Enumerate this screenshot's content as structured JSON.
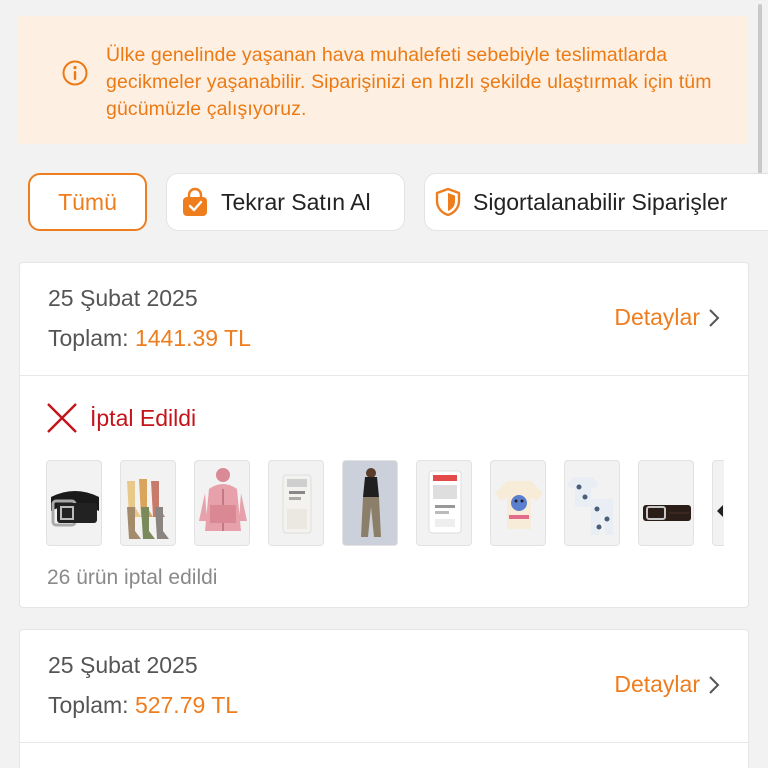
{
  "notice": {
    "text": "Ülke genelinde yaşanan hava muhalefeti sebebiyle teslimatlarda gecikmeler yaşanabilir. Siparişinizi en hızlı şekilde ulaştırmak için tüm gücümüzle çalışıyoruz.",
    "icon": "info-icon"
  },
  "filters": [
    {
      "label": "Tümü",
      "active": true
    },
    {
      "label": "Tekrar Satın Al",
      "icon": "shopping-bag-icon"
    },
    {
      "label": "Sigortalanabilir Siparişler",
      "icon": "shield-icon"
    }
  ],
  "orders": [
    {
      "date": "25 Şubat 2025",
      "total_label": "Toplam:",
      "total_value": "1441.39 TL",
      "details_label": "Detaylar",
      "status": "İptal Edildi",
      "canceled_count": "26 ürün iptal edildi",
      "products": [
        "belt",
        "socks",
        "pink-jacket",
        "white-socks-pack",
        "woman-outfit",
        "tights-pack",
        "stitch-sweatshirt",
        "pajama-set",
        "brown-belt",
        "partial-item"
      ]
    },
    {
      "date": "25 Şubat 2025",
      "total_label": "Toplam:",
      "total_value": "527.79 TL",
      "details_label": "Detaylar"
    }
  ],
  "colors": {
    "accent": "#ee7d1e",
    "cancel": "#c4141a",
    "notice_bg": "#fdefe1"
  }
}
